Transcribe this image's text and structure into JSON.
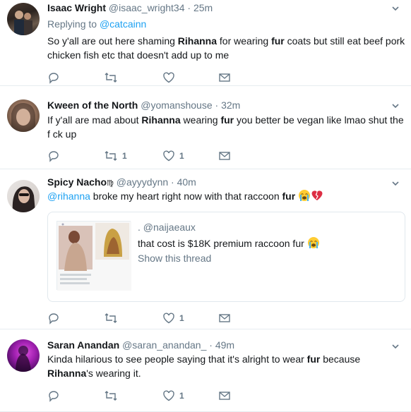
{
  "tweets": [
    {
      "name": "Isaac Wright",
      "handle": "@isaac_wright34",
      "time": "· 25m",
      "reply_prefix": "Replying to",
      "reply_to": "@catcainn",
      "text_parts": [
        "So y'all are out here shaming ",
        "Rihanna",
        " for wearing ",
        "fur",
        " coats but still eat beef pork chicken fish etc that doesn't add up to me"
      ],
      "retweets": "",
      "likes": ""
    },
    {
      "name": "Kween of the North",
      "handle": "@yomanshouse",
      "time": "· 32m",
      "text_parts": [
        "If y'all are mad about ",
        "Rihanna",
        " wearing ",
        "fur",
        " you better be vegan like lmao shut the f  ck up"
      ],
      "retweets": "1",
      "likes": "1"
    },
    {
      "name": "Spicy Nacho",
      "name_badge": "♍",
      "handle": "@ayyydynn",
      "time": "· 40m",
      "mention": "@rihanna",
      "text_parts": [
        " broke my heart right now with that raccoon ",
        "fur"
      ],
      "quote": {
        "author": ". @naijaeaux",
        "text": "that cost is $18K premium raccoon fur",
        "show_thread": "Show this thread"
      },
      "retweets": "",
      "likes": "1"
    },
    {
      "name": "Saran Anandan",
      "handle": "@saran_anandan_",
      "time": "· 49m",
      "text_parts": [
        "Kinda hilarious to see people saying that it's alright to wear ",
        "fur",
        " because ",
        "Rihanna",
        "'s wearing it."
      ],
      "retweets": "",
      "likes": "1"
    }
  ],
  "colors": {
    "text": "#14171a",
    "muted": "#657786",
    "link": "#1da1f2",
    "border": "#e6ecf0"
  },
  "icons": [
    "reply-icon",
    "retweet-icon",
    "like-icon",
    "direct-message-icon",
    "caret-down-icon",
    "loudly-crying-face-emoji",
    "broken-heart-emoji"
  ]
}
